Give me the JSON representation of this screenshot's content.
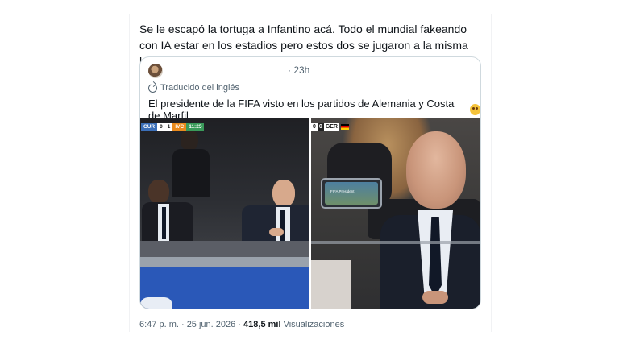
{
  "tweet": {
    "text": "Se le escapó la tortuga a Infantino acá. Todo el mundial fakeando con IA estar en los estadios pero estos dos se jugaron a la misma hora."
  },
  "quote": {
    "avatar_icon": "avatar",
    "time": "· 23h",
    "translated_label": "Traducido del inglés",
    "text": "El presidente de la FIFA visto en los partidos de Alemania y Costa de Marfil",
    "emoji": "flushed-face-emoji"
  },
  "photos": {
    "left": {
      "scorebug": {
        "home": "CUR",
        "score_home": "0",
        "score_away": "1",
        "away": "IVC",
        "clock": "11:25"
      },
      "colors": {
        "home": "#3b6fb8",
        "away": "#e98a1d",
        "clock": "#3a9a5a"
      }
    },
    "right": {
      "scorebug": {
        "score_a": "0",
        "score_b": "0",
        "team": "GER"
      },
      "phone_text": "FIFA President"
    }
  },
  "meta": {
    "time_date": "6:47 p. m. · 25 jun. 2026 ·",
    "views_count": "418,5 mil",
    "views_label": "Visualizaciones"
  }
}
